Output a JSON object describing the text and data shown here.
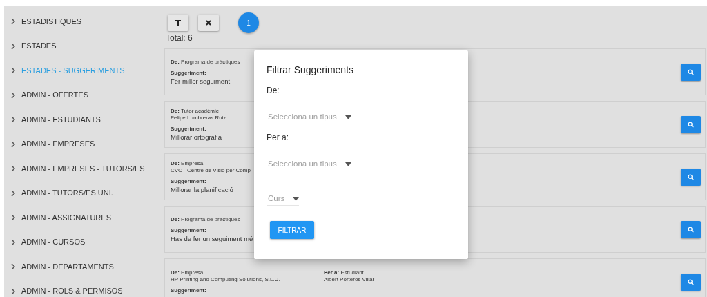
{
  "sidebar": {
    "items": [
      {
        "label": "ESTADISTIQUES",
        "selected": false
      },
      {
        "label": "ESTADES",
        "selected": false
      },
      {
        "label": "ESTADES - SUGGERIMENTS",
        "selected": true
      },
      {
        "label": "ADMIN - OFERTES",
        "selected": false
      },
      {
        "label": "ADMIN - ESTUDIANTS",
        "selected": false
      },
      {
        "label": "ADMIN - EMPRESES",
        "selected": false
      },
      {
        "label": "ADMIN - EMPRESES - TUTORS/ES",
        "selected": false
      },
      {
        "label": "ADMIN - TUTORS/ES UNI.",
        "selected": false
      },
      {
        "label": "ADMIN - ASSIGNATURES",
        "selected": false
      },
      {
        "label": "ADMIN - CURSOS",
        "selected": false
      },
      {
        "label": "ADMIN - DEPARTAMENTS",
        "selected": false
      },
      {
        "label": "ADMIN - ROLS & PERMISOS",
        "selected": false
      }
    ]
  },
  "toolbar": {
    "badge": "1"
  },
  "total": "Total: 6",
  "cards": [
    {
      "from": "**De:** Programa de pràctiques",
      "suggestion_label": "Suggeriment:",
      "suggestion": "Fer millor seguiment"
    },
    {
      "from": "**De:** Tutor acadèmic",
      "from_name": "Felipe Lumbreras Ruiz",
      "suggestion_label": "Suggeriment:",
      "suggestion": "Millorar ortografia"
    },
    {
      "from": "**De:** Empresa",
      "from_name": "CVC - Centre de Visió per Comp",
      "suggestion_label": "Suggeriment:",
      "suggestion": "Millorar la planificació"
    },
    {
      "from": "**De:** Programa de pràctiques",
      "suggestion_label": "Suggeriment:",
      "suggestion": "Has de fer un seguiment mé"
    },
    {
      "from": "**De:** Empresa",
      "from_name": "HP Printing and Computing Solutions, S.L.U.",
      "to": "**Per a:** Estudiant",
      "to_name": "Albert Porteros Villar",
      "suggestion_label": "Suggeriment:"
    }
  ],
  "dialog": {
    "title": "Filtrar Suggeriments",
    "fields": [
      {
        "label": "De:",
        "placeholder": "Selecciona un tipus"
      },
      {
        "label": "Per a:",
        "placeholder": "Selecciona un tipus"
      },
      {
        "placeholder": "Curs"
      }
    ],
    "button": "FILTRAR"
  }
}
